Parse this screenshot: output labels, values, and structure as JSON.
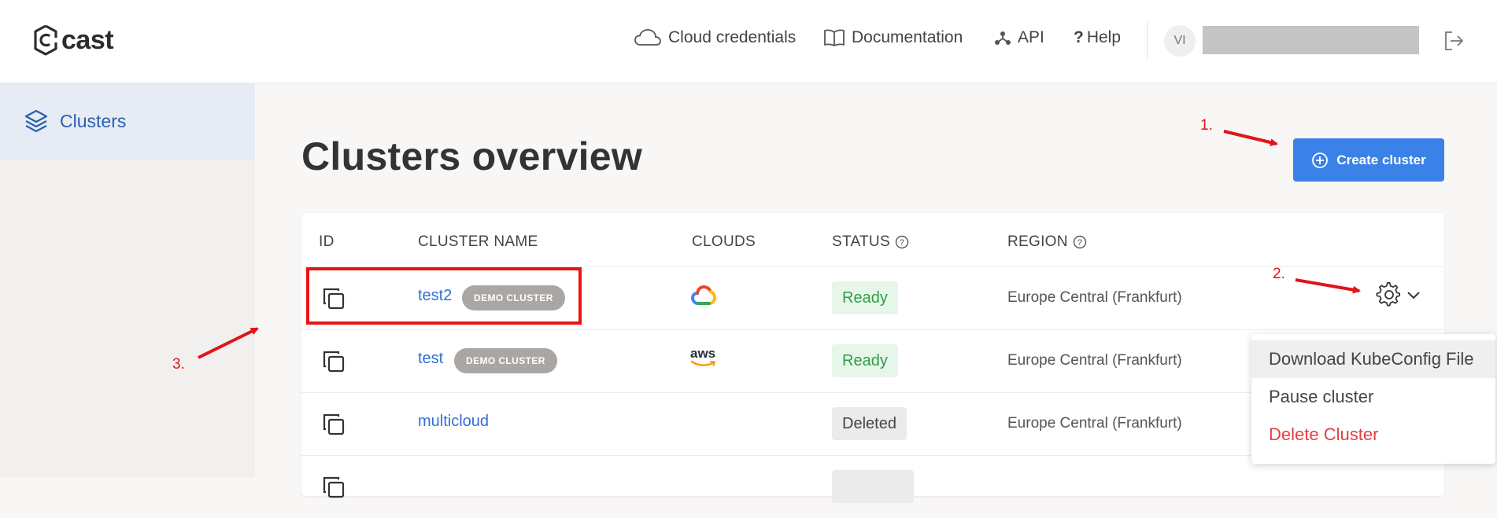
{
  "brand": {
    "name": "cast"
  },
  "nav": {
    "cloud_credentials": "Cloud credentials",
    "documentation": "Documentation",
    "api": "API",
    "help": "Help"
  },
  "user": {
    "initials": "VI"
  },
  "sidebar": {
    "items": [
      {
        "label": "Clusters",
        "icon": "layers-icon"
      }
    ]
  },
  "main": {
    "title": "Clusters overview",
    "create_button": "Create cluster",
    "table": {
      "columns": [
        "ID",
        "CLUSTER NAME",
        "CLOUDS",
        "STATUS",
        "REGION"
      ],
      "rows": [
        {
          "name": "test2",
          "badge": "DEMO CLUSTER",
          "cloud": "gcp-icon",
          "status": "Ready",
          "region": "Europe Central (Frankfurt)"
        },
        {
          "name": "test",
          "badge": "DEMO CLUSTER",
          "cloud": "aws",
          "status": "Ready",
          "region": "Europe Central (Frankfurt)"
        },
        {
          "name": "multicloud",
          "badge": "",
          "cloud": "",
          "status": "Deleted",
          "region": "Europe Central (Frankfurt)"
        }
      ]
    }
  },
  "dropdown": {
    "items": [
      {
        "label": "Download KubeConfig File"
      },
      {
        "label": "Pause cluster"
      },
      {
        "label": "Delete Cluster"
      }
    ]
  },
  "annotations": {
    "step1": "1.",
    "step2": "2.",
    "step3": "3."
  },
  "colors": {
    "accent": "#3b82e8",
    "link": "#2f6fd6",
    "ready_bg": "#e7f6ea",
    "ready_text": "#2e9e47",
    "deleted_bg": "#ebebeb",
    "danger": "#e53e3e",
    "annotation": "#e0141a"
  }
}
